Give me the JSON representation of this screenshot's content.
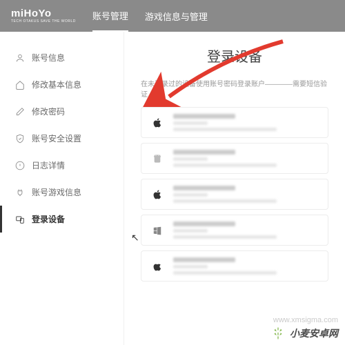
{
  "brand": {
    "name": "miHoYo",
    "tagline": "TECH OTAKUS SAVE THE WORLD"
  },
  "nav": {
    "tabs": [
      {
        "label": "账号管理",
        "active": true
      },
      {
        "label": "游戏信息与管理",
        "active": false
      }
    ]
  },
  "sidebar": {
    "items": [
      {
        "label": "账号信息",
        "icon": "user-icon"
      },
      {
        "label": "修改基本信息",
        "icon": "home-icon"
      },
      {
        "label": "修改密码",
        "icon": "pencil-icon"
      },
      {
        "label": "账号安全设置",
        "icon": "shield-icon"
      },
      {
        "label": "日志详情",
        "icon": "info-icon"
      },
      {
        "label": "账号游戏信息",
        "icon": "plug-icon"
      },
      {
        "label": "登录设备",
        "icon": "screens-icon",
        "active": true
      }
    ]
  },
  "main": {
    "title": "登录设备",
    "note": "在未登录过的设备使用账号密码登录账户————需要短信验证"
  },
  "devices": [
    {
      "platform": "apple"
    },
    {
      "platform": "android"
    },
    {
      "platform": "apple"
    },
    {
      "platform": "windows"
    },
    {
      "platform": "apple"
    }
  ],
  "watermark": {
    "text": "小麦安卓网",
    "url": "www.xmsigma.com"
  },
  "colors": {
    "arrow": "#e23a2e",
    "topbar": "#8a8a8a"
  }
}
